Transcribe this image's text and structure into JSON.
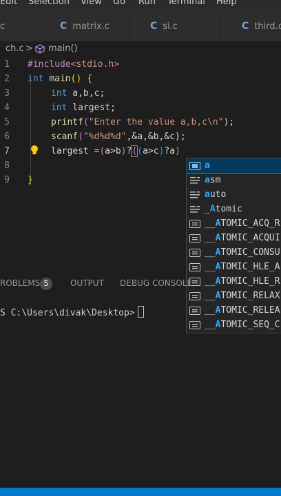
{
  "menu": [
    "Edit",
    "Selection",
    "View",
    "Go",
    "Run",
    "Terminal",
    "Help"
  ],
  "tabs": [
    {
      "label": "c",
      "icon": "c-file-icon"
    },
    {
      "label": "matrix.c",
      "icon": "c-file-icon"
    },
    {
      "label": "si.c",
      "icon": "c-file-icon"
    },
    {
      "label": "third.c",
      "icon": "c-file-icon"
    }
  ],
  "breadcrumb": {
    "file": "ch.c",
    "separator": ">",
    "symbol": "main()"
  },
  "editor": {
    "line_numbers": [
      "1",
      "2",
      "3",
      "4",
      "5",
      "6",
      "7",
      "8",
      "9"
    ],
    "line1": {
      "pp": "#include",
      "rest": "<stdio.h>"
    },
    "line2": {
      "kw": "int",
      "fn": "main",
      "rest": "() {"
    },
    "line3": {
      "kw": "int",
      "rest": " a,b,c;"
    },
    "line4": {
      "kw": "int",
      "rest": " largest;"
    },
    "line5": {
      "fn": "printf",
      "open": "(",
      "str": "\"Enter the value a,b,c\\n\"",
      "close": ");"
    },
    "line6": {
      "fn": "scanf",
      "open": "(",
      "str": "\"%d%d%d\"",
      "rest": ",&a,&b,&c);"
    },
    "line7": {
      "p1": "largest =",
      "p2": "(",
      "p3": "a>b",
      "p4": ")",
      "p5": "?",
      "p6": "(",
      "p7": "(",
      "p8": "a>c",
      "p9": ")",
      "p10": "?a",
      "p11": ")"
    },
    "line9": "}"
  },
  "suggestions": [
    {
      "pre": "",
      "match": "a",
      "post": "",
      "icon": "variable-icon"
    },
    {
      "pre": "",
      "match": "a",
      "post": "sm",
      "icon": "keyword-icon"
    },
    {
      "pre": "",
      "match": "a",
      "post": "uto",
      "icon": "keyword-icon"
    },
    {
      "pre": "_",
      "match": "A",
      "post": "tomic",
      "icon": "keyword-icon"
    },
    {
      "pre": "__",
      "match": "A",
      "post": "TOMIC_ACQ_R",
      "icon": "constant-icon"
    },
    {
      "pre": "__",
      "match": "A",
      "post": "TOMIC_ACQUI",
      "icon": "constant-icon"
    },
    {
      "pre": "__",
      "match": "A",
      "post": "TOMIC_CONSU",
      "icon": "constant-icon"
    },
    {
      "pre": "__",
      "match": "A",
      "post": "TOMIC_HLE_A",
      "icon": "constant-icon"
    },
    {
      "pre": "__",
      "match": "A",
      "post": "TOMIC_HLE_R",
      "icon": "constant-icon"
    },
    {
      "pre": "__",
      "match": "A",
      "post": "TOMIC_RELAX",
      "icon": "constant-icon"
    },
    {
      "pre": "__",
      "match": "A",
      "post": "TOMIC_RELEA",
      "icon": "constant-icon"
    },
    {
      "pre": "__",
      "match": "A",
      "post": "TOMIC_SEQ_C",
      "icon": "constant-icon"
    }
  ],
  "panel": {
    "problems": "ROBLEMS",
    "problems_count": "5",
    "output": "OUTPUT",
    "debug": "DEBUG CONSOLE",
    "prompt": "S C:\\Users\\divak\\Desktop>"
  },
  "colors": {
    "accent": "#007acc",
    "keyword": "#569cd6",
    "function": "#dcdcaa",
    "string": "#ce9178",
    "preprocessor": "#c586c0"
  }
}
